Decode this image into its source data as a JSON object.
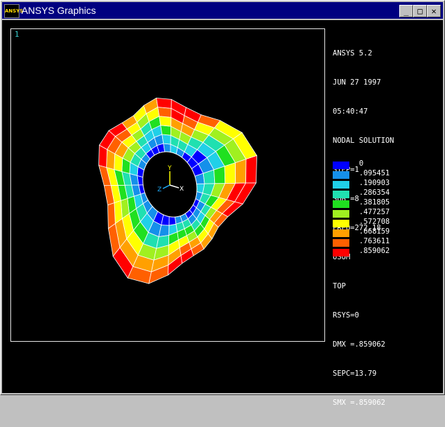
{
  "window": {
    "title": "ANSYS Graphics",
    "icon_label": "ANSYS",
    "minimize_glyph": "_",
    "maximize_glyph": "□",
    "close_glyph": "✕"
  },
  "viewport": {
    "window_number": "1",
    "model_colors": [
      "#0000ff",
      "#1590ea",
      "#20d0e8",
      "#20e0b0",
      "#20e020",
      "#a0f020",
      "#ffff00",
      "#ffa000",
      "#ff6000",
      "#ff0000"
    ],
    "triad": {
      "x_label": "X",
      "y_label": "Y",
      "z_label": "Z",
      "colors": {
        "x": "#ffffff",
        "y": "#ffff00",
        "z": "#20b0ff"
      }
    }
  },
  "info": {
    "lines": [
      "ANSYS 5.2",
      "JUN 27 1997",
      "05:40:47",
      "NODAL SOLUTION",
      "STEP=1",
      "SUB =8",
      "FREQ=272.18",
      "USUM",
      "TOP",
      "RSYS=0",
      "DMX =.859062",
      "SEPC=13.79",
      "SMX =.859062"
    ]
  },
  "legend": {
    "items": [
      {
        "label": "0",
        "color": "#0000ff"
      },
      {
        "label": ".095451",
        "color": "#1590ea"
      },
      {
        "label": ".190903",
        "color": "#20d0e8"
      },
      {
        "label": ".286354",
        "color": "#20e0b0"
      },
      {
        "label": ".381805",
        "color": "#20e020"
      },
      {
        "label": ".477257",
        "color": "#a0f020"
      },
      {
        "label": ".572708",
        "color": "#ffff00"
      },
      {
        "label": ".668159",
        "color": "#ffa000"
      },
      {
        "label": ".763611",
        "color": "#ff6000"
      },
      {
        "label": ".859062",
        "color": "#ff0000"
      }
    ]
  }
}
